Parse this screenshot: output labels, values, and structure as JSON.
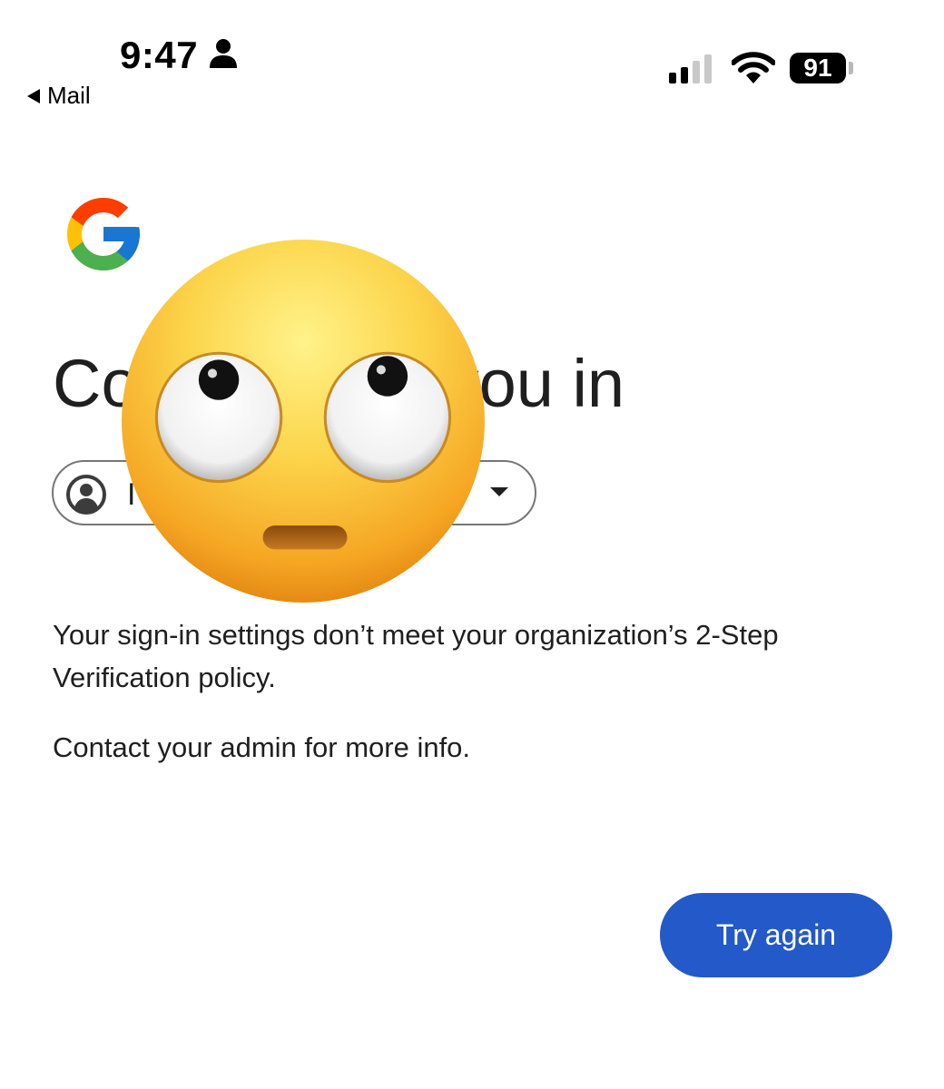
{
  "status_bar": {
    "time": "9:47",
    "back_app": "Mail",
    "battery_level": "91",
    "signal_bars_filled": 2,
    "signal_bars_total": 4,
    "icons": [
      "person-icon",
      "cellular-signal-icon",
      "wifi-icon",
      "battery-icon"
    ]
  },
  "header": {
    "logo": "google-g-logo",
    "title_visible_left": "Co",
    "title_visible_right": "you in"
  },
  "account_chip": {
    "visible_initial": "I",
    "icon": "account-circle-icon",
    "caret": "chevron-down-icon"
  },
  "overlay": {
    "emoji": "face-with-rolling-eyes"
  },
  "message": {
    "line1": "Your sign-in settings don’t meet your organization’s 2-Step Verification policy.",
    "line2": "Contact your admin for more info."
  },
  "actions": {
    "try_again_label": "Try again"
  },
  "colors": {
    "primary_button": "#2359c8",
    "text": "#1f1f1f",
    "outline": "#747775",
    "google_blue": "#4285F4",
    "google_red": "#EA4335",
    "google_yellow": "#FBBC05",
    "google_green": "#34A853"
  }
}
